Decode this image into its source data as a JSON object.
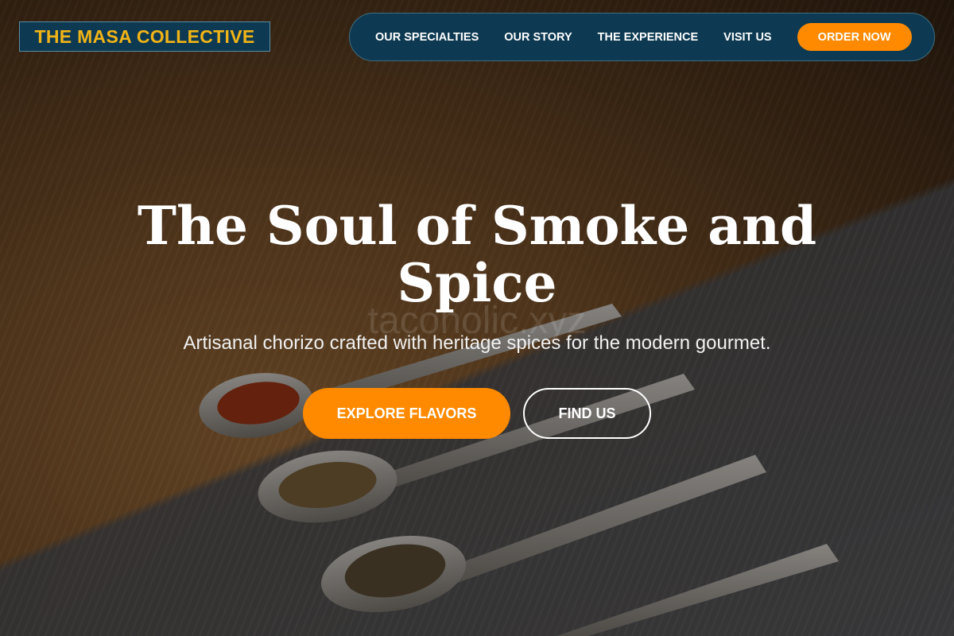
{
  "brand": {
    "name": "THE MASA COLLECTIVE"
  },
  "nav": {
    "items": [
      {
        "label": "OUR SPECIALTIES"
      },
      {
        "label": "OUR STORY"
      },
      {
        "label": "THE EXPERIENCE"
      },
      {
        "label": "VISIT US"
      }
    ],
    "cta_label": "ORDER NOW"
  },
  "hero": {
    "title": "The Soul of Smoke and Spice",
    "subtitle": "Artisanal chorizo crafted with heritage spices for the modern gourmet.",
    "watermark": "tacoholic.xyz",
    "primary_button": "EXPLORE FLAVORS",
    "secondary_button": "FIND US"
  },
  "colors": {
    "nav_background": "#0d3a52",
    "logo_text": "#f2b416",
    "accent": "#ff8a00",
    "text": "#ffffff"
  }
}
